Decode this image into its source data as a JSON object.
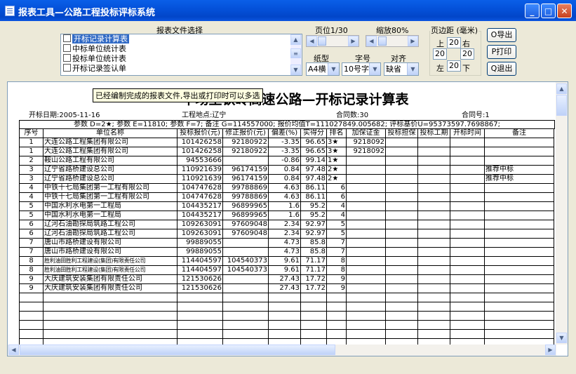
{
  "window": {
    "title": "报表工具—公路工程投标评标系统",
    "minimize": "_",
    "maximize": "□",
    "close": "✕"
  },
  "panel": {
    "files_label": "报表文件选择",
    "files": [
      {
        "label": "开标记录计算表",
        "selected": true
      },
      {
        "label": "中标单位统计表",
        "selected": false
      },
      {
        "label": "投标单位统计表",
        "selected": false
      },
      {
        "label": "开标记录签认单",
        "selected": false
      }
    ],
    "page_label": "页位1/30",
    "zoom_label": "缩放80%",
    "paper_label": "纸型",
    "paper_value": "A4横",
    "font_label": "字号",
    "font_value": "10号字",
    "align_label": "对齐",
    "align_value": "缺省",
    "margin_label": "页边距 (毫米)",
    "margin_top_label": "上",
    "margin_top": "20",
    "margin_right_label": "右",
    "margin_right": "20",
    "margin_left_label": "左",
    "margin_left": "20",
    "margin_bottom_label": "下",
    "margin_bottom": "20",
    "margin_mid": "20",
    "export_button": "O导出",
    "print_button": "P打印",
    "exit_button": "Q退出"
  },
  "report": {
    "tooltip": "已经编制完成的报表文件,导出或打印时可以多选",
    "title": "辛场至铁岭高速公路—开标记录计算表",
    "open_date": "开标日期:2005-11-16",
    "location": "工程地点:辽宁",
    "contract_count": "合同数:30",
    "contract_no": "合同号:1",
    "params": "参数 D=2★; 参数 E=11810; 参数 F=7; 备注 G=114557000; 报价均值T=111027849.005682; 评标基价U=95373597.7698867;",
    "headers": [
      "序号",
      "单位名称",
      "投标报价(元)",
      "修正报价(元)",
      "偏差(%)",
      "实得分",
      "排名",
      "加保证金",
      "投标担保",
      "投标工期",
      "开标时间",
      "备注"
    ],
    "rows": [
      [
        "1",
        "大连公路工程集团有限公司",
        "101426258",
        "92180922",
        "-3.35",
        "96.65",
        "3★",
        "9218092",
        "",
        "",
        "",
        ""
      ],
      [
        "1",
        "大连公路工程集团有限公司",
        "101426258",
        "92180922",
        "-3.35",
        "96.65",
        "3★",
        "9218092",
        "",
        "",
        "",
        ""
      ],
      [
        "2",
        "鞍山公路工程有限公司",
        "94553666",
        "",
        "-0.86",
        "99.14",
        "1★",
        "",
        "",
        "",
        "",
        ""
      ],
      [
        "3",
        "辽宁省路桥建设总公司",
        "110921639",
        "96174159",
        "0.84",
        "97.48",
        "2★",
        "",
        "",
        "",
        "",
        "推荐中标"
      ],
      [
        "3",
        "辽宁省路桥建设总公司",
        "110921639",
        "96174159",
        "0.84",
        "97.48",
        "2★",
        "",
        "",
        "",
        "",
        "推荐中标"
      ],
      [
        "4",
        "中铁十七局集团第一工程有限公司",
        "104747628",
        "99788869",
        "4.63",
        "86.11",
        "6",
        "",
        "",
        "",
        "",
        ""
      ],
      [
        "4",
        "中铁十七局集团第一工程有限公司",
        "104747628",
        "99788869",
        "4.63",
        "86.11",
        "6",
        "",
        "",
        "",
        "",
        ""
      ],
      [
        "5",
        "中国水利水电第一工程局",
        "104435217",
        "96899965",
        "1.6",
        "95.2",
        "4",
        "",
        "",
        "",
        "",
        ""
      ],
      [
        "5",
        "中国水利水电第一工程局",
        "104435217",
        "96899965",
        "1.6",
        "95.2",
        "4",
        "",
        "",
        "",
        "",
        ""
      ],
      [
        "6",
        "辽河石油勘探局筑路工程公司",
        "109263091",
        "97609048",
        "2.34",
        "92.97",
        "5",
        "",
        "",
        "",
        "",
        ""
      ],
      [
        "6",
        "辽河石油勘探局筑路工程公司",
        "109263091",
        "97609048",
        "2.34",
        "92.97",
        "5",
        "",
        "",
        "",
        "",
        ""
      ],
      [
        "7",
        "唐山市路桥建设有限公司",
        "99889055",
        "",
        "4.73",
        "85.8",
        "7",
        "",
        "",
        "",
        "",
        ""
      ],
      [
        "7",
        "唐山市路桥建设有限公司",
        "99889055",
        "",
        "4.73",
        "85.8",
        "7",
        "",
        "",
        "",
        "",
        ""
      ],
      [
        "8",
        "胜利油田胜利工程建设(集团)有限责任公司",
        "114404597",
        "104540373",
        "9.61",
        "71.17",
        "8",
        "",
        "",
        "",
        "",
        ""
      ],
      [
        "8",
        "胜利油田胜利工程建设(集团)有限责任公司",
        "114404597",
        "104540373",
        "9.61",
        "71.17",
        "8",
        "",
        "",
        "",
        "",
        ""
      ],
      [
        "9",
        "大庆建筑安装集团有限责任公司",
        "121530626",
        "",
        "27.43",
        "17.72",
        "9",
        "",
        "",
        "",
        "",
        ""
      ],
      [
        "9",
        "大庆建筑安装集团有限责任公司",
        "121530626",
        "",
        "27.43",
        "17.72",
        "9",
        "",
        "",
        "",
        "",
        ""
      ]
    ],
    "empty_rows": 6
  }
}
